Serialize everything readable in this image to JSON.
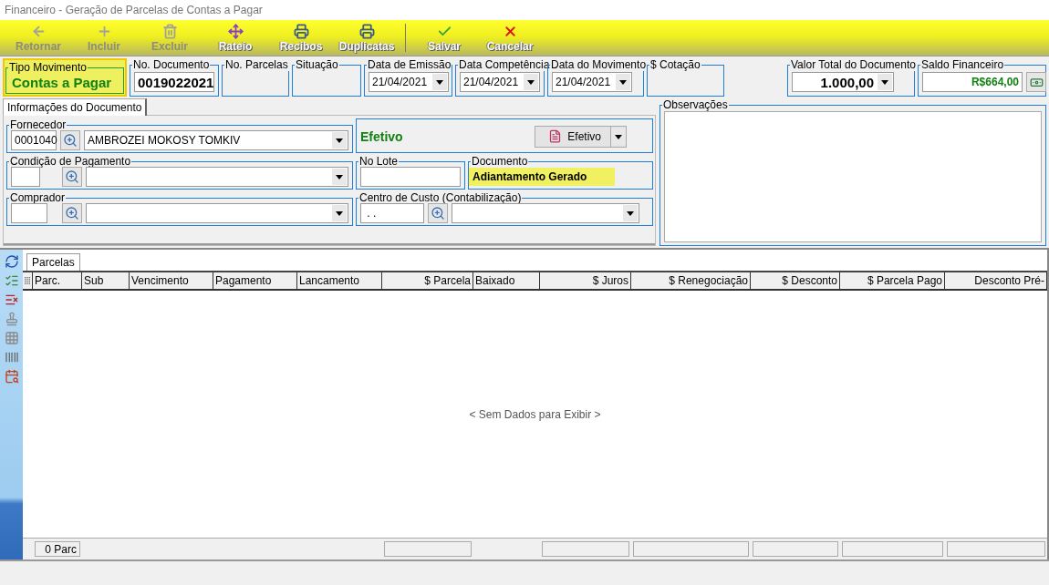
{
  "window": {
    "title": "Financeiro - Geração de Parcelas de Contas a Pagar"
  },
  "toolbar": [
    {
      "kind": "back",
      "label": "Retornar",
      "disabled": true
    },
    {
      "kind": "add",
      "label": "Incluir",
      "disabled": true
    },
    {
      "kind": "delete",
      "label": "Excluir",
      "disabled": true
    },
    {
      "kind": "split",
      "label": "Rateio",
      "disabled": false
    },
    {
      "kind": "print",
      "label": "Recibos",
      "disabled": false
    },
    {
      "kind": "print",
      "label": "Duplicatas",
      "disabled": false
    },
    {
      "kind": "save",
      "label": "Salvar",
      "disabled": false
    },
    {
      "kind": "cancel",
      "label": "Cancelar",
      "disabled": false
    }
  ],
  "header": {
    "tipo_movimento": {
      "label": "Tipo Movimento",
      "value": "Contas a Pagar"
    },
    "no_documento": {
      "label": "No. Documento",
      "value": "0019022021"
    },
    "no_parcelas": {
      "label": "No. Parcelas"
    },
    "situacao": {
      "label": "Situação"
    },
    "data_emissao": {
      "label": "Data de Emissão",
      "value": "21/04/2021"
    },
    "data_competencia": {
      "label": "Data Competência",
      "value": "21/04/2021"
    },
    "data_movimento": {
      "label": "Data do Movimento",
      "value": "21/04/2021"
    },
    "cotacao": {
      "label": "$ Cotação"
    },
    "valor_total": {
      "label": "Valor Total do Documento",
      "value": "1.000,00"
    },
    "saldo_financeiro": {
      "label": "Saldo Financeiro",
      "value": "R$664,00"
    }
  },
  "tabs": [
    {
      "label": "Informações do Documento",
      "selected": true
    }
  ],
  "form": {
    "fornecedor": {
      "label": "Fornecedor",
      "code": "0001040",
      "name": "AMBROZEI MOKOSY TOMKIV"
    },
    "status": {
      "value": "Efetivo",
      "button": "Efetivo"
    },
    "condicao_pagamento": {
      "label": "Condição de Pagamento"
    },
    "no_lote": {
      "label": "No Lote"
    },
    "documento": {
      "label": "Documento",
      "value": "Adiantamento Gerado"
    },
    "comprador": {
      "label": "Comprador"
    },
    "centro_custo": {
      "label": "Centro de Custo (Contabilização)",
      "value": ".  ."
    }
  },
  "observacoes": {
    "label": "Observações"
  },
  "grid": {
    "tabs": [
      {
        "label": "Parcelas",
        "selected": true
      }
    ],
    "columns": [
      {
        "label": "Parc.",
        "right_aligned": false,
        "totals": false
      },
      {
        "label": "Sub",
        "right_aligned": false,
        "totals": false
      },
      {
        "label": "Vencimento",
        "right_aligned": false,
        "totals": false
      },
      {
        "label": "Pagamento",
        "right_aligned": false,
        "totals": false
      },
      {
        "label": "Lancamento",
        "right_aligned": false,
        "totals": false
      },
      {
        "label": "$ Parcela",
        "right_aligned": true,
        "totals": true
      },
      {
        "label": "Baixado",
        "right_aligned": false,
        "totals": false
      },
      {
        "label": "$ Juros",
        "right_aligned": true,
        "totals": true
      },
      {
        "label": "$ Renegociação",
        "right_aligned": true,
        "totals": true
      },
      {
        "label": "$ Desconto",
        "right_aligned": true,
        "totals": true
      },
      {
        "label": "$ Parcela Pago",
        "right_aligned": true,
        "totals": true
      },
      {
        "label": "Desconto Pré-",
        "right_aligned": true,
        "totals": true
      }
    ],
    "empty_message": "< Sem Dados para Exibir >",
    "count": "0 Parc"
  }
}
